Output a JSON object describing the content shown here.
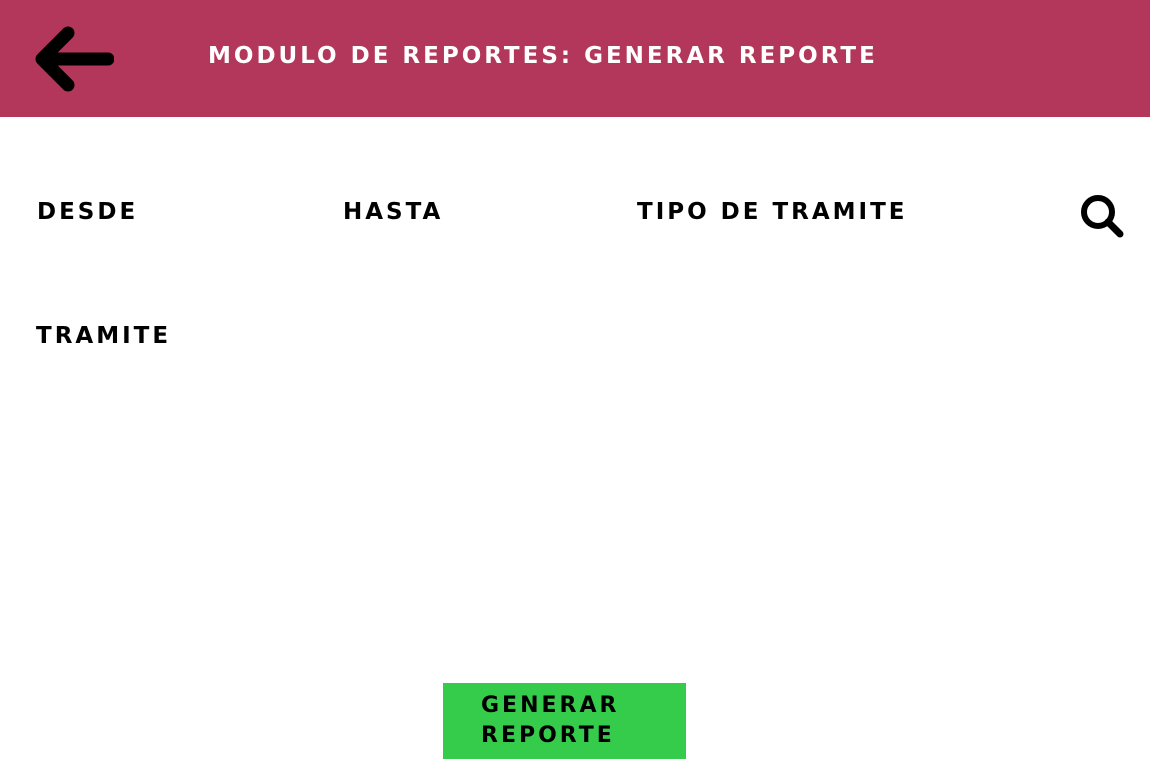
{
  "header": {
    "title": "MODULO DE REPORTES: GENERAR REPORTE",
    "back_icon": "arrow-left-icon"
  },
  "filters": {
    "desde_label": "DESDE",
    "hasta_label": "HASTA",
    "tipo_tramite_label": "TIPO DE TRAMITE",
    "tramite_label": "TRAMITE",
    "search_icon": "search-icon"
  },
  "actions": {
    "generate_label": "GENERAR REPORTE"
  },
  "colors": {
    "header_bg": "#b3375a",
    "header_text": "#ffffff",
    "button_bg": "#35cc4b",
    "text": "#000000"
  }
}
